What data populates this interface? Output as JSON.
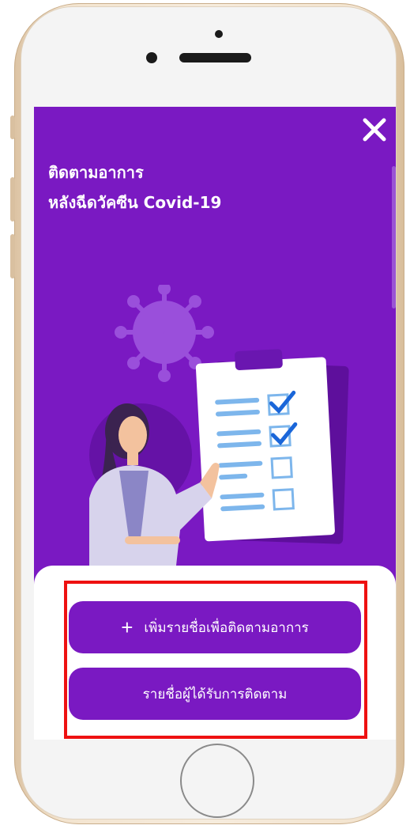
{
  "header": {
    "title_line1": "ติดตามอาการ",
    "title_line2": "หลังฉีดวัคซีน Covid-19"
  },
  "actions": {
    "add_label": "เพิ่มรายชื่อเพื่อติดตามอาการ",
    "add_icon": "+",
    "list_label": "รายชื่อผู้ได้รับการติดตาม"
  },
  "colors": {
    "primary": "#7a19c2",
    "highlight": "#ee1111"
  }
}
